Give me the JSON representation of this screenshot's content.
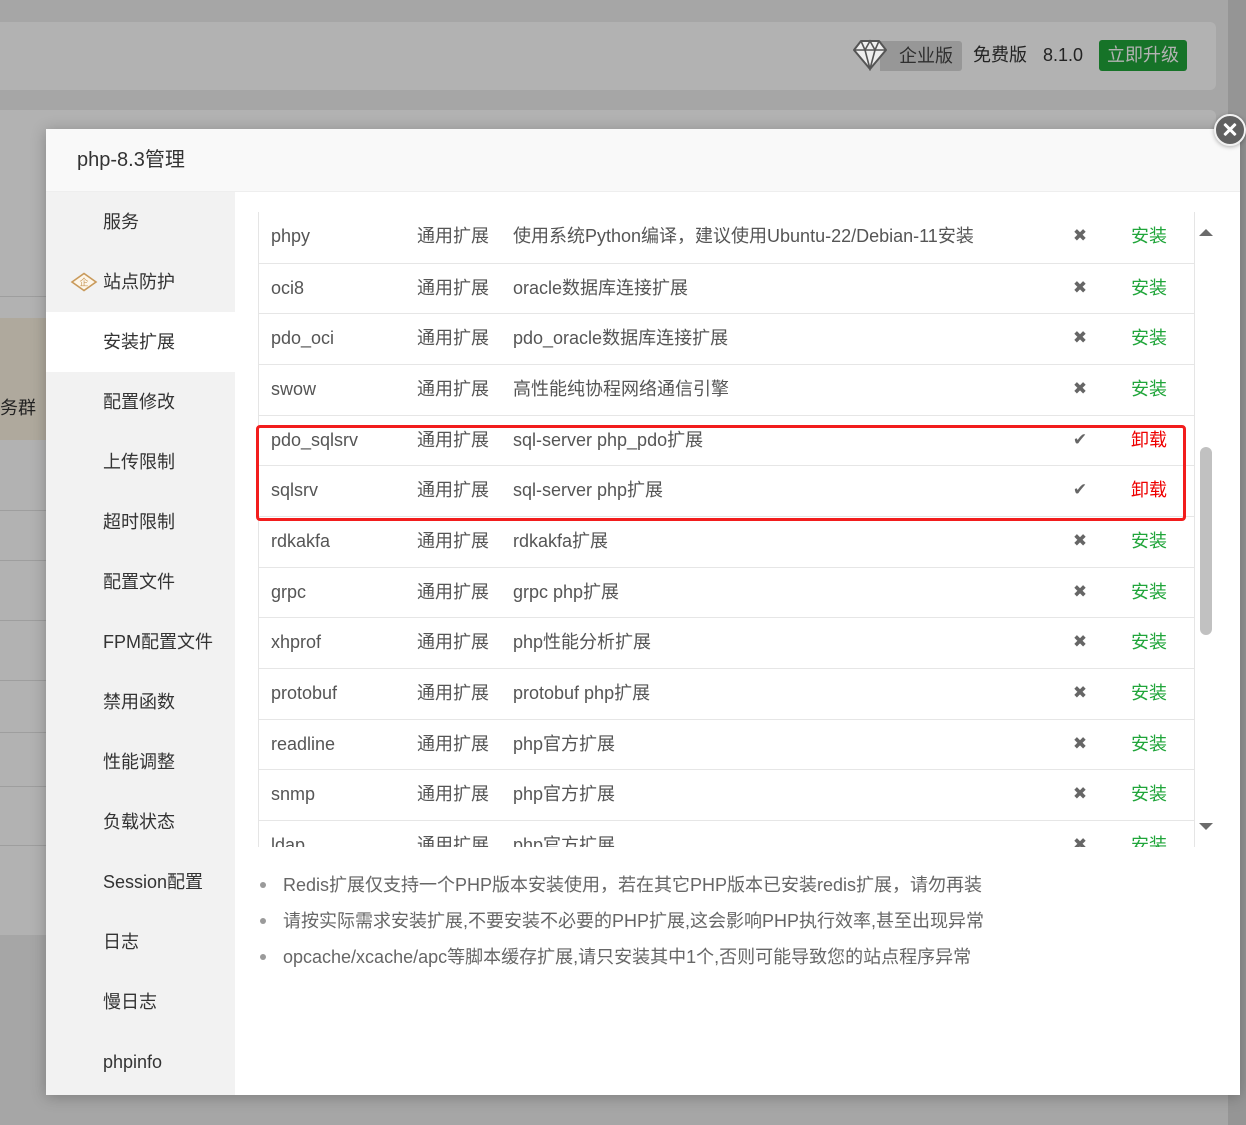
{
  "header": {
    "diamond_icon": "diamond-icon",
    "edition_badge": "企业版",
    "free_label": "免费版",
    "version": "8.1.0",
    "upgrade_button": "立即升级"
  },
  "background": {
    "fragment_text": "务群"
  },
  "modal": {
    "title": "php-8.3管理",
    "close_icon": "close-icon",
    "sidebar": {
      "items": [
        {
          "label": "服务"
        },
        {
          "label": "站点防护",
          "icon": "enterprise-diamond-icon",
          "icon_text": "企"
        },
        {
          "label": "安装扩展",
          "active": true
        },
        {
          "label": "配置修改"
        },
        {
          "label": "上传限制"
        },
        {
          "label": "超时限制"
        },
        {
          "label": "配置文件"
        },
        {
          "label": "FPM配置文件"
        },
        {
          "label": "禁用函数"
        },
        {
          "label": "性能调整"
        },
        {
          "label": "负载状态"
        },
        {
          "label": "Session配置"
        },
        {
          "label": "日志"
        },
        {
          "label": "慢日志"
        },
        {
          "label": "phpinfo"
        }
      ]
    },
    "extensions": [
      {
        "name": "phpy",
        "type": "通用扩展",
        "description": "使用系统Python编译，建议使用Ubuntu-22/Debian-11安装",
        "status_icon": "cross-icon",
        "action": "安装"
      },
      {
        "name": "oci8",
        "type": "通用扩展",
        "description": "oracle数据库连接扩展",
        "status_icon": "cross-icon",
        "action": "安装"
      },
      {
        "name": "pdo_oci",
        "type": "通用扩展",
        "description": "pdo_oracle数据库连接扩展",
        "status_icon": "cross-icon",
        "action": "安装"
      },
      {
        "name": "swow",
        "type": "通用扩展",
        "description": "高性能纯协程网络通信引擎",
        "status_icon": "cross-icon",
        "action": "安装"
      },
      {
        "name": "pdo_sqlsrv",
        "type": "通用扩展",
        "description": "sql-server php_pdo扩展",
        "status_icon": "check-icon",
        "action": "卸载"
      },
      {
        "name": "sqlsrv",
        "type": "通用扩展",
        "description": "sql-server php扩展",
        "status_icon": "check-icon",
        "action": "卸载"
      },
      {
        "name": "rdkakfa",
        "type": "通用扩展",
        "description": "rdkakfa扩展",
        "status_icon": "cross-icon",
        "action": "安装"
      },
      {
        "name": "grpc",
        "type": "通用扩展",
        "description": "grpc php扩展",
        "status_icon": "cross-icon",
        "action": "安装"
      },
      {
        "name": "xhprof",
        "type": "通用扩展",
        "description": "php性能分析扩展",
        "status_icon": "cross-icon",
        "action": "安装"
      },
      {
        "name": "protobuf",
        "type": "通用扩展",
        "description": "protobuf php扩展",
        "status_icon": "cross-icon",
        "action": "安装"
      },
      {
        "name": "readline",
        "type": "通用扩展",
        "description": "php官方扩展",
        "status_icon": "cross-icon",
        "action": "安装"
      },
      {
        "name": "snmp",
        "type": "通用扩展",
        "description": "php官方扩展",
        "status_icon": "cross-icon",
        "action": "安装"
      },
      {
        "name": "ldap",
        "type": "通用扩展",
        "description": "php官方扩展",
        "status_icon": "cross-icon",
        "action": "安装"
      }
    ],
    "notes": [
      "Redis扩展仅支持一个PHP版本安装使用，若在其它PHP版本已安装redis扩展，请勿再装",
      "请按实际需求安装扩展,不要安装不必要的PHP扩展,这会影响PHP执行效率,甚至出现异常",
      "opcache/xcache/apc等脚本缓存扩展,请只安装其中1个,否则可能导致您的站点程序异常"
    ]
  },
  "colors": {
    "install": "#20a53a",
    "uninstall": "#ee0000",
    "highlight_border": "#f21d1d",
    "upgrade_button": "#20a53a",
    "enterprise_icon": "#c99a5b"
  }
}
